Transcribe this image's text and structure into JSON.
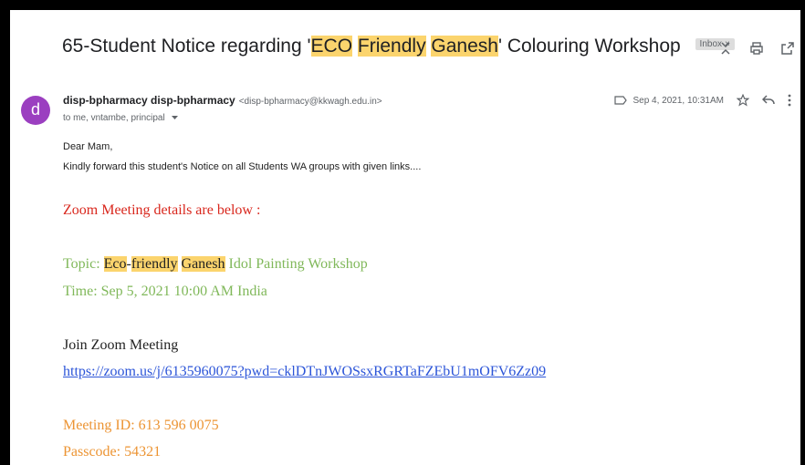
{
  "email": {
    "subject": {
      "pre": "65-Student Notice regarding '",
      "hl1": "ECO",
      "hl2": "Friendly",
      "hl3": "Ganesh",
      "post": "' Colouring Workshop"
    },
    "label": "Inbox",
    "sender_initial": "d",
    "sender_name": "disp-bpharmacy disp-bpharmacy",
    "sender_email": "<disp-bpharmacy@kkwagh.edu.in>",
    "recipients": "to me, vntambe, principal",
    "date": "Sep 4, 2021, 10:31AM",
    "greeting": "Dear Mam,",
    "intro": "Kindly forward this student's Notice on all Students WA groups with given links....",
    "zoom_heading": "Zoom Meeting details are below :",
    "topic_label": "Topic: ",
    "topic_hl1": "Eco",
    "topic_mid": "-",
    "topic_hl2": "friendly",
    "topic_hl3": "Ganesh",
    "topic_rest": " Idol Painting Workshop",
    "time": "Time: Sep 5, 2021 10:00 AM India",
    "join_label": "Join Zoom Meeting",
    "join_link": "https://zoom.us/j/6135960075?pwd=cklDTnJWOSsxRGRTaFZEbU1mOFV6Zz09",
    "meeting_id": "Meeting ID: 613 596 0075",
    "passcode": "Passcode: 54321"
  },
  "icons": [
    "expand-collapse-icon",
    "print-icon",
    "open-new-window-icon",
    "label-icon",
    "star-icon",
    "reply-icon",
    "more-vert-icon",
    "dropdown-arrow-icon"
  ],
  "colors": {
    "highlight": "#fbd46d",
    "heading_red": "#d9281e",
    "green": "#80b85a",
    "orange": "#ec9433",
    "link": "#2c55d8",
    "avatar": "#9b3fc0"
  }
}
